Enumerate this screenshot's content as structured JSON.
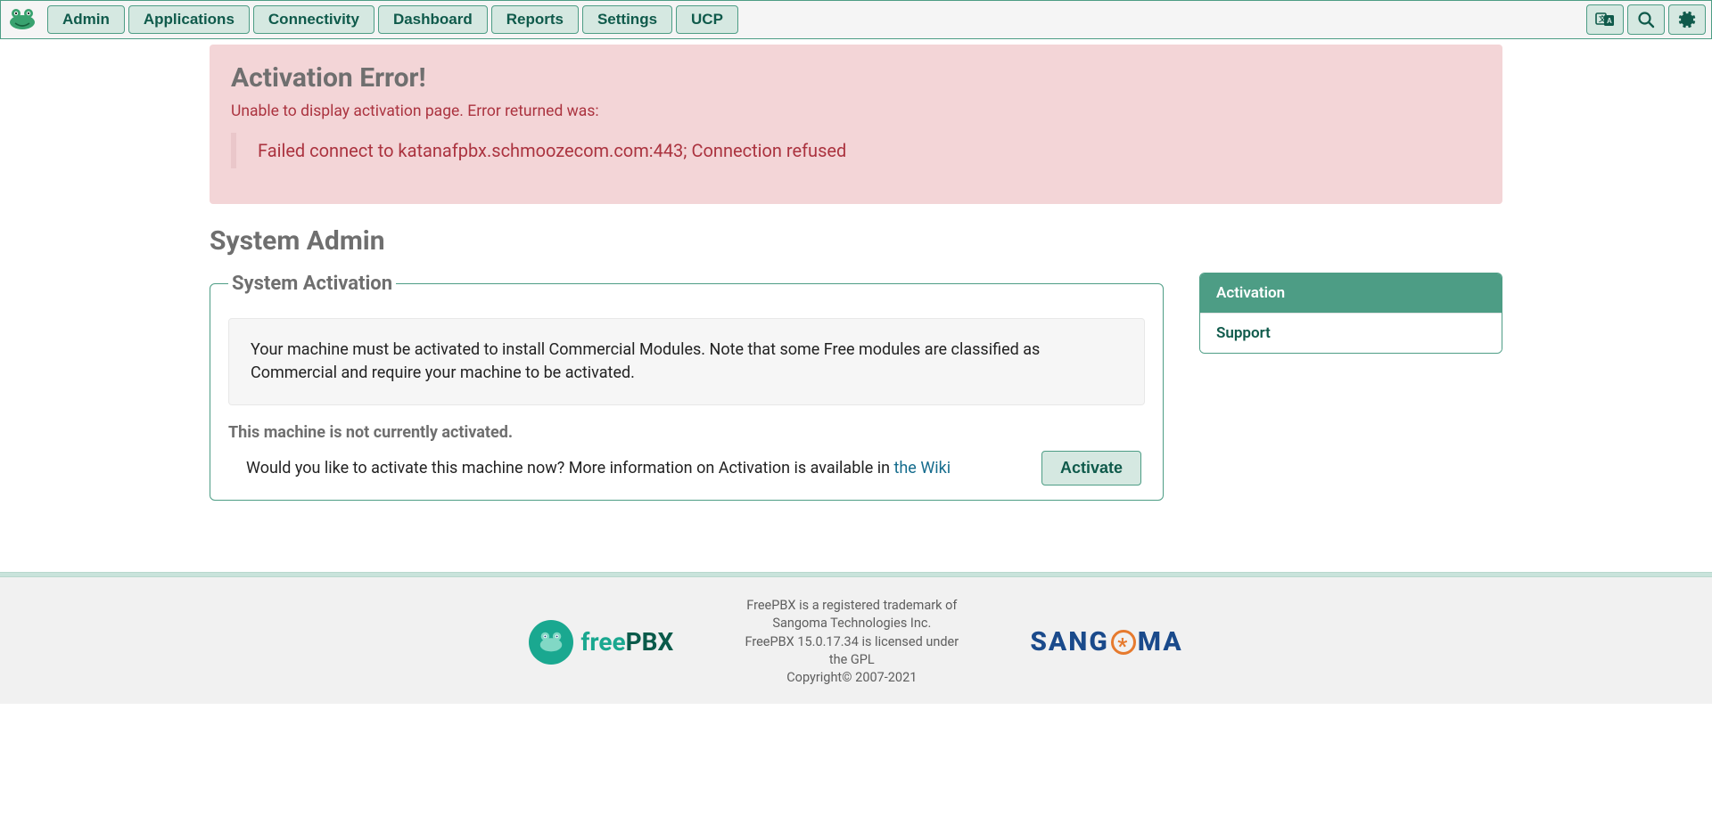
{
  "nav": {
    "items": [
      "Admin",
      "Applications",
      "Connectivity",
      "Dashboard",
      "Reports",
      "Settings",
      "UCP"
    ]
  },
  "alert": {
    "title": "Activation Error!",
    "message": "Unable to display activation page. Error returned was:",
    "detail": "Failed connect to katanafpbx.schmoozecom.com:443; Connection refused"
  },
  "page": {
    "title": "System Admin"
  },
  "panel": {
    "legend": "System Activation",
    "well_text": "Your machine must be activated to install Commercial Modules. Note that some Free modules are classified as Commercial and require your machine to be activated.",
    "not_activated": "This machine is not currently activated.",
    "activate_prompt_pre": "Would you like to activate this machine now? More information on Activation is available in ",
    "activate_link": "the Wiki",
    "activate_button": "Activate"
  },
  "sidebar": {
    "items": [
      {
        "label": "Activation",
        "active": true
      },
      {
        "label": "Support",
        "active": false
      }
    ]
  },
  "footer": {
    "line1": "FreePBX is a registered trademark of Sangoma Technologies Inc.",
    "line2": "FreePBX 15.0.17.34 is licensed under the GPL",
    "line3": "Copyright© 2007-2021"
  },
  "brand": {
    "freepbx_free": "free",
    "freepbx_pbx": "PBX",
    "sangoma_pre": "SANG",
    "sangoma_post": "MA"
  }
}
